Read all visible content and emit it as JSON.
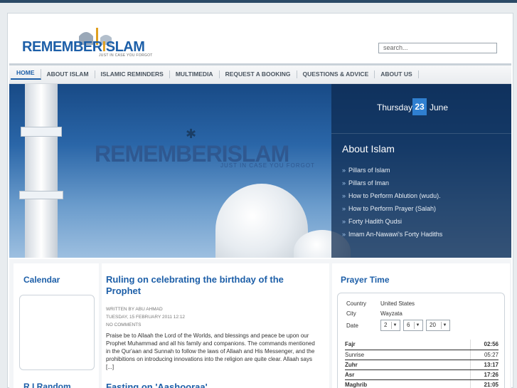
{
  "header": {
    "logo_main": "REMEMBER",
    "logo_slam": "SLAM",
    "logo_tagline": "JUST IN CASE YOU FORGOT",
    "search_placeholder": "search..."
  },
  "nav": {
    "items": [
      {
        "label": "HOME"
      },
      {
        "label": "ABOUT ISLAM"
      },
      {
        "label": "ISLAMIC REMINDERS"
      },
      {
        "label": "MULTIMEDIA"
      },
      {
        "label": "REQUEST A BOOKING"
      },
      {
        "label": "QUESTIONS & ADVICE"
      },
      {
        "label": "ABOUT US"
      }
    ]
  },
  "banner": {
    "logo_main": "REMEMBER",
    "logo_slam": "SLAM",
    "tagline": "JUST IN CASE YOU FORGOT",
    "date": {
      "weekday": "Thursday",
      "day": "23",
      "month": "June"
    },
    "about_title": "About Islam",
    "about_links": [
      "Pillars of Islam",
      "Pillars of Iman",
      "How to Perform Ablution (wudu).",
      "How to Perform Prayer (Salah)",
      "Forty Hadith Qudsi",
      "Imam An-Nawawi's Forty Hadiths"
    ]
  },
  "left": {
    "calendar_title": "Calendar",
    "random_title": "R.I Random"
  },
  "article": {
    "title": "Ruling on celebrating the birthday of the Prophet",
    "author": "WRITTEN BY ABU AHMAD",
    "date": "TUESDAY, 15 FEBRUARY 2011 12:12",
    "comments": "NO COMMENTS",
    "body": "Praise be to Allaah the Lord of the Worlds, and blessings and peace be upon our Prophet Muhammad and all his family and companions. The commands mentioned in the Qur'aan and Sunnah to follow the laws of Allaah and His Messenger, and the prohibitions on introducing innovations into the religion are quite clear. Allaah says [...]",
    "next_title": "Fasting on 'Aashooraa'"
  },
  "prayer": {
    "title": "Prayer Time",
    "country_label": "Country",
    "country_value": "United States",
    "city_label": "City",
    "city_value": "Wayzata",
    "date_label": "Date",
    "date_day": "2",
    "date_month": "6",
    "date_year": "20",
    "times": [
      {
        "name": "Fajr",
        "time": "02:56",
        "bold": true
      },
      {
        "name": "Sunrise",
        "time": "05:27",
        "bold": false
      },
      {
        "name": "Zuhr",
        "time": "13:17",
        "bold": true
      },
      {
        "name": "Asr",
        "time": "17:26",
        "bold": true
      },
      {
        "name": "Maghrib",
        "time": "21:05",
        "bold": true
      }
    ]
  }
}
